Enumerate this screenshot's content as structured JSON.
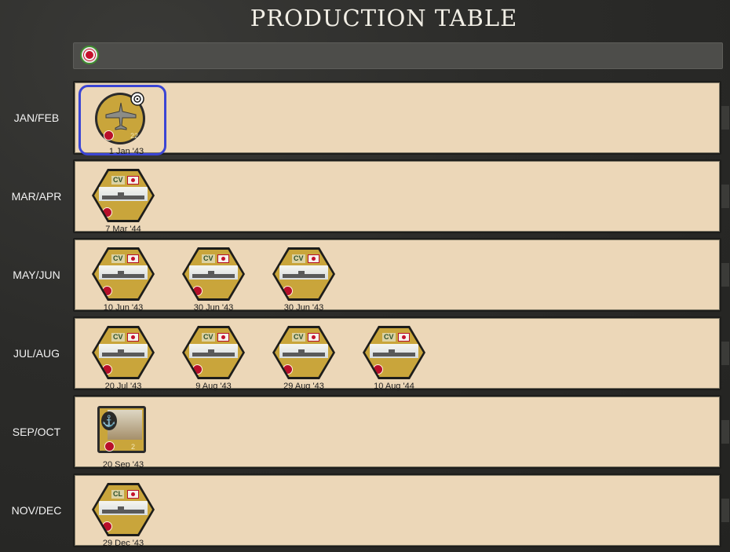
{
  "title": "PRODUCTION TABLE",
  "faction": {
    "icon": "japan-flag-icon"
  },
  "colors": {
    "counter": "#c9a53b",
    "row_bg": "#ecd7b8",
    "selection": "#3b45d4",
    "pip": "#b80f2a"
  },
  "rows": [
    {
      "label": "JAN/FEB",
      "units": [
        {
          "type": "aircraft",
          "date": "1 Jan '43",
          "value": "22",
          "selected": true
        }
      ]
    },
    {
      "label": "MAR/APR",
      "units": [
        {
          "type": "ship",
          "class": "CV",
          "date": "7 Mar '44"
        }
      ]
    },
    {
      "label": "MAY/JUN",
      "units": [
        {
          "type": "ship",
          "class": "CV",
          "date": "10 Jun '43"
        },
        {
          "type": "ship",
          "class": "CV",
          "date": "30 Jun '43"
        },
        {
          "type": "ship",
          "class": "CV",
          "date": "30 Jun '43"
        }
      ]
    },
    {
      "label": "JUL/AUG",
      "units": [
        {
          "type": "ship",
          "class": "CV",
          "date": "20 Jul '43"
        },
        {
          "type": "ship",
          "class": "CV",
          "date": "9 Aug '43"
        },
        {
          "type": "ship",
          "class": "CV",
          "date": "29 Aug '43"
        },
        {
          "type": "ship",
          "class": "CV",
          "date": "10 Aug '44"
        }
      ]
    },
    {
      "label": "SEP/OCT",
      "units": [
        {
          "type": "infantry",
          "date": "20 Sep '43",
          "value": "2"
        }
      ]
    },
    {
      "label": "NOV/DEC",
      "units": [
        {
          "type": "ship",
          "class": "CL",
          "date": "29 Dec '43"
        }
      ]
    }
  ]
}
